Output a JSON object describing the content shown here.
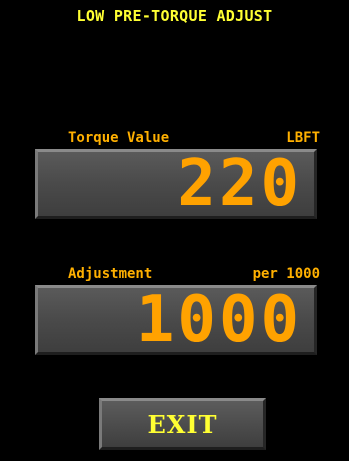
{
  "header": {
    "title": "LOW PRE-TORQUE ADJUST"
  },
  "torque": {
    "label": "Torque Value",
    "unit": "LBFT",
    "value": "220"
  },
  "adjustment": {
    "label": "Adjustment",
    "unit": "per 1000",
    "value": "1000"
  },
  "exit": {
    "label": "EXIT"
  },
  "colors": {
    "background": "#000000",
    "title": "#ffff33",
    "label": "#ffb000",
    "value": "#ffa200",
    "panel": "#4a4a4a"
  }
}
